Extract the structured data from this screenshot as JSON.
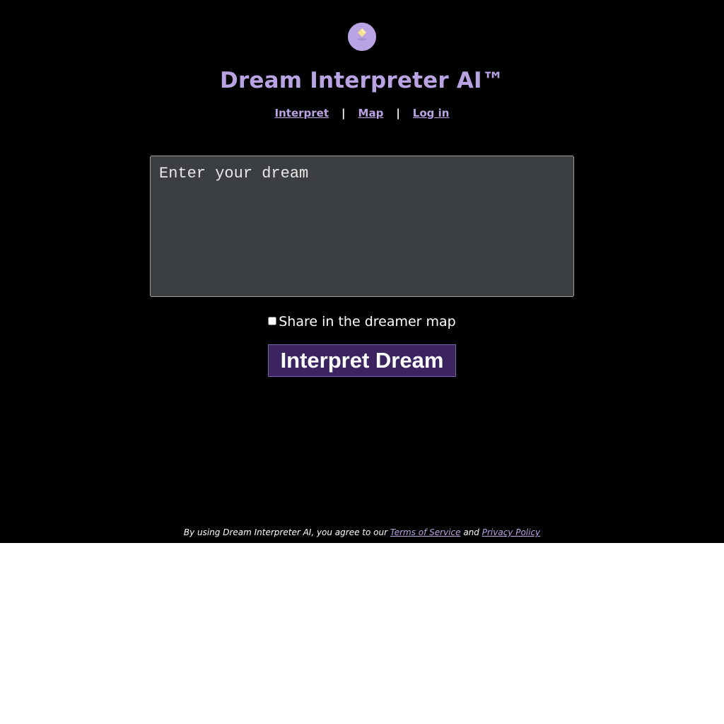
{
  "header": {
    "logo_icon": "crystal-ball-icon",
    "title": "Dream Interpreter AI™"
  },
  "nav": {
    "items": [
      {
        "label": "Interpret"
      },
      {
        "label": "Map"
      },
      {
        "label": "Log in"
      }
    ],
    "separator": "|"
  },
  "form": {
    "dream_placeholder": "Enter your dream",
    "dream_value": "",
    "share_label": "Share in the dreamer map",
    "share_checked": false,
    "submit_label": "Interpret Dream"
  },
  "footer": {
    "prefix": "By using Dream Interpreter AI, you agree to our ",
    "terms_label": "Terms of Service",
    "conjunction": " and ",
    "privacy_label": "Privacy Policy"
  },
  "colors": {
    "background": "#000000",
    "accent": "#b9a3e3",
    "button": "#3b2460",
    "input_bg": "#3c3f42"
  }
}
